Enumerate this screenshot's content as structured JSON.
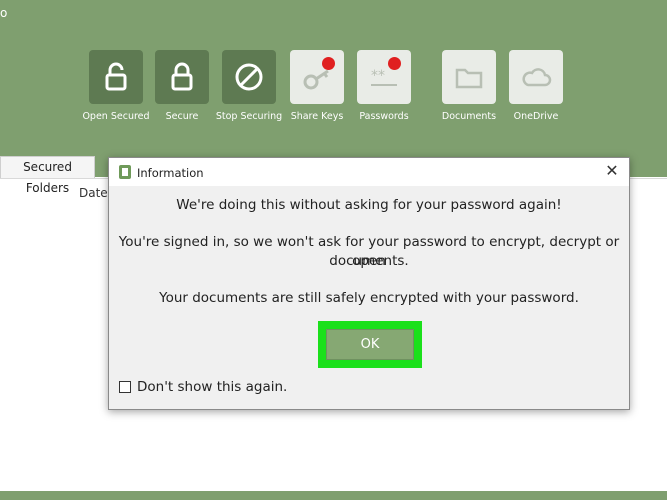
{
  "window": {
    "corner_glyph": "o"
  },
  "ribbon": {
    "buttons": [
      {
        "label": "Open Secured",
        "icon": "open-padlock-icon"
      },
      {
        "label": "Secure",
        "icon": "padlock-icon"
      },
      {
        "label": "Stop Securing",
        "icon": "prohibit-icon"
      },
      {
        "label": "Share Keys",
        "icon": "key-icon"
      },
      {
        "label": "Passwords",
        "icon": "password-icon"
      },
      {
        "label": "Documents",
        "icon": "folder-icon"
      },
      {
        "label": "OneDrive",
        "icon": "cloud-icon"
      }
    ],
    "colors": {
      "background": "#7f9f6f",
      "dark_button": "#5e7a52",
      "light_button": "#e9ece7",
      "badge": "#e02020"
    }
  },
  "tabs": {
    "secured_folders": "Secured Folders"
  },
  "table": {
    "columns": {
      "date": "Date"
    }
  },
  "dialog": {
    "title": "Information",
    "close_glyph": "✕",
    "headline": "We're doing this without asking for your password again!",
    "body_line1": "You're signed in, so we won't ask for your password to encrypt, decrypt or open",
    "body_line2": "documents.",
    "body_line3": "Your documents are still safely encrypted with your password.",
    "ok_label": "OK",
    "dont_show_label": "Don't show this again.",
    "dont_show_checked": false,
    "highlight_color": "#1be01b"
  }
}
